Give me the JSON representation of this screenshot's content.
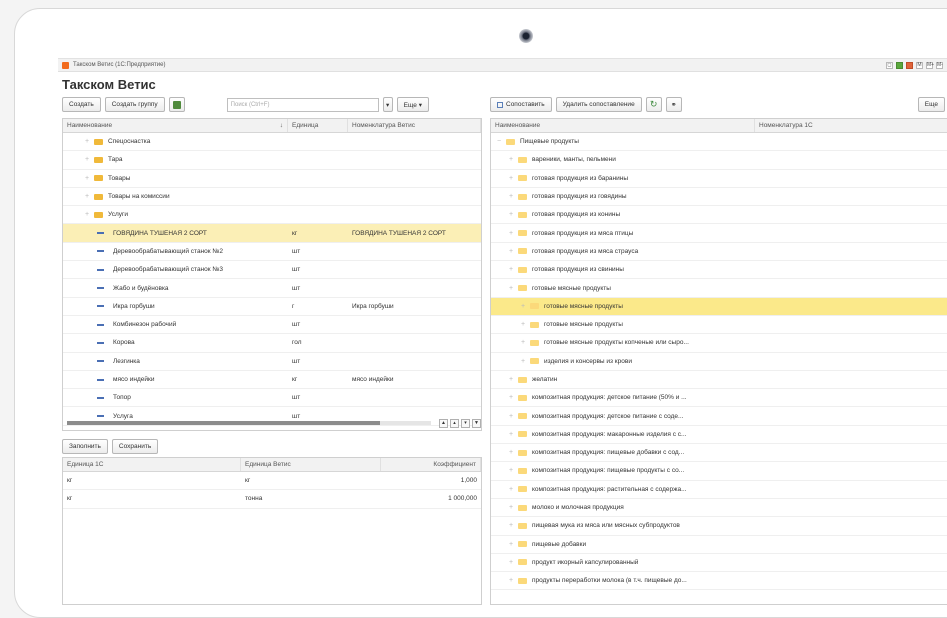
{
  "window": {
    "titlebar": "Такском Ветис  (1С:Предприятие)",
    "form_title": "Такском Ветис",
    "tools": [
      "◻",
      "▤",
      "▢",
      "M",
      "M+",
      "M-"
    ]
  },
  "left_toolbar": {
    "create": "Создать",
    "create_group": "Создать группу",
    "search_placeholder": "Поиск (Ctrl+F)",
    "more": "Еще ▾"
  },
  "left_table": {
    "headers": [
      "Наименование",
      "Единица",
      "Номенклатура Ветис"
    ],
    "rows": [
      {
        "kind": "folder",
        "name": "Спецоснастка",
        "unit": "",
        "nom": ""
      },
      {
        "kind": "folder",
        "name": "Тара",
        "unit": "",
        "nom": ""
      },
      {
        "kind": "folder",
        "name": "Товары",
        "unit": "",
        "nom": ""
      },
      {
        "kind": "folder",
        "name": "Товары на комиссии",
        "unit": "",
        "nom": ""
      },
      {
        "kind": "folder",
        "name": "Услуги",
        "unit": "",
        "nom": ""
      },
      {
        "kind": "item",
        "name": "ГОВЯДИНА ТУШЕНАЯ 2 СОРТ",
        "unit": "кг",
        "nom": "ГОВЯДИНА ТУШЕНАЯ 2 СОРТ",
        "selected": true
      },
      {
        "kind": "item",
        "name": "Деревообрабатывающий станок №2",
        "unit": "шт",
        "nom": ""
      },
      {
        "kind": "item",
        "name": "Деревообрабатывающий станок №3",
        "unit": "шт",
        "nom": ""
      },
      {
        "kind": "item",
        "name": "Жабо и будёновка",
        "unit": "шт",
        "nom": ""
      },
      {
        "kind": "item",
        "name": "Икра горбуши",
        "unit": "г",
        "nom": "Икра горбуши"
      },
      {
        "kind": "item",
        "name": "Комбинезон рабочий",
        "unit": "шт",
        "nom": ""
      },
      {
        "kind": "item",
        "name": "Корова",
        "unit": "гол",
        "nom": ""
      },
      {
        "kind": "item",
        "name": "Лезгинка",
        "unit": "шт",
        "nom": ""
      },
      {
        "kind": "item",
        "name": "мясо индейки",
        "unit": "кг",
        "nom": "мясо индейки"
      },
      {
        "kind": "item",
        "name": "Топор",
        "unit": "шт",
        "nom": ""
      },
      {
        "kind": "item",
        "name": "Услуга",
        "unit": "шт",
        "nom": ""
      }
    ]
  },
  "bottom_toolbar": {
    "fill": "Заполнить",
    "save": "Сохранить"
  },
  "bottom_table": {
    "headers": [
      "Единица 1С",
      "Единица Ветис",
      "Коэффициент"
    ],
    "rows": [
      {
        "u1c": "кг",
        "uv": "кг",
        "k": "1,000"
      },
      {
        "u1c": "кг",
        "uv": "тонна",
        "k": "1 000,000"
      }
    ]
  },
  "right_toolbar": {
    "compare": "Сопоставить",
    "delete_compare": "Удалить сопоставление",
    "more": "Еще"
  },
  "right_table": {
    "headers": [
      "Наименование",
      "Номенклатура 1С"
    ],
    "rows": [
      {
        "level": 0,
        "name": "Пищевые продукты"
      },
      {
        "level": 1,
        "name": "вареники, манты, пельмени"
      },
      {
        "level": 1,
        "name": "готовая продукция из баранины"
      },
      {
        "level": 1,
        "name": "готовая продукция из говядины"
      },
      {
        "level": 1,
        "name": "готовая продукция из конины"
      },
      {
        "level": 1,
        "name": "готовая продукция из мяса птицы"
      },
      {
        "level": 1,
        "name": "готовая продукция из мяса страуса"
      },
      {
        "level": 1,
        "name": "готовая продукция из свинины"
      },
      {
        "level": 1,
        "name": "готовые мясные продукты"
      },
      {
        "level": 2,
        "name": "готовые мясные продукты",
        "selected": true
      },
      {
        "level": 2,
        "name": "готовые мясные продукты"
      },
      {
        "level": 2,
        "name": "готовые мясные продукты копченые или сыро..."
      },
      {
        "level": 2,
        "name": "изделия и консервы из крови"
      },
      {
        "level": 1,
        "name": "желатин"
      },
      {
        "level": 1,
        "name": "композитная продукция: детское питание (50% и ..."
      },
      {
        "level": 1,
        "name": "композитная продукция: детское питание с соде..."
      },
      {
        "level": 1,
        "name": "композитная продукция: макаронные изделия с с..."
      },
      {
        "level": 1,
        "name": "композитная продукция: пищевые добавки с сод..."
      },
      {
        "level": 1,
        "name": "композитная продукция: пищевые продукты с со..."
      },
      {
        "level": 1,
        "name": "композитная продукция: растительная с содержа..."
      },
      {
        "level": 1,
        "name": "молоко и молочная продукция"
      },
      {
        "level": 1,
        "name": "пищевая мука из мяса или мясных субпродуктов"
      },
      {
        "level": 1,
        "name": "пищевые добавки"
      },
      {
        "level": 1,
        "name": "продукт икорный капсулированный"
      },
      {
        "level": 1,
        "name": "продукты переработки молока (в т.ч. пищевые до..."
      }
    ]
  }
}
